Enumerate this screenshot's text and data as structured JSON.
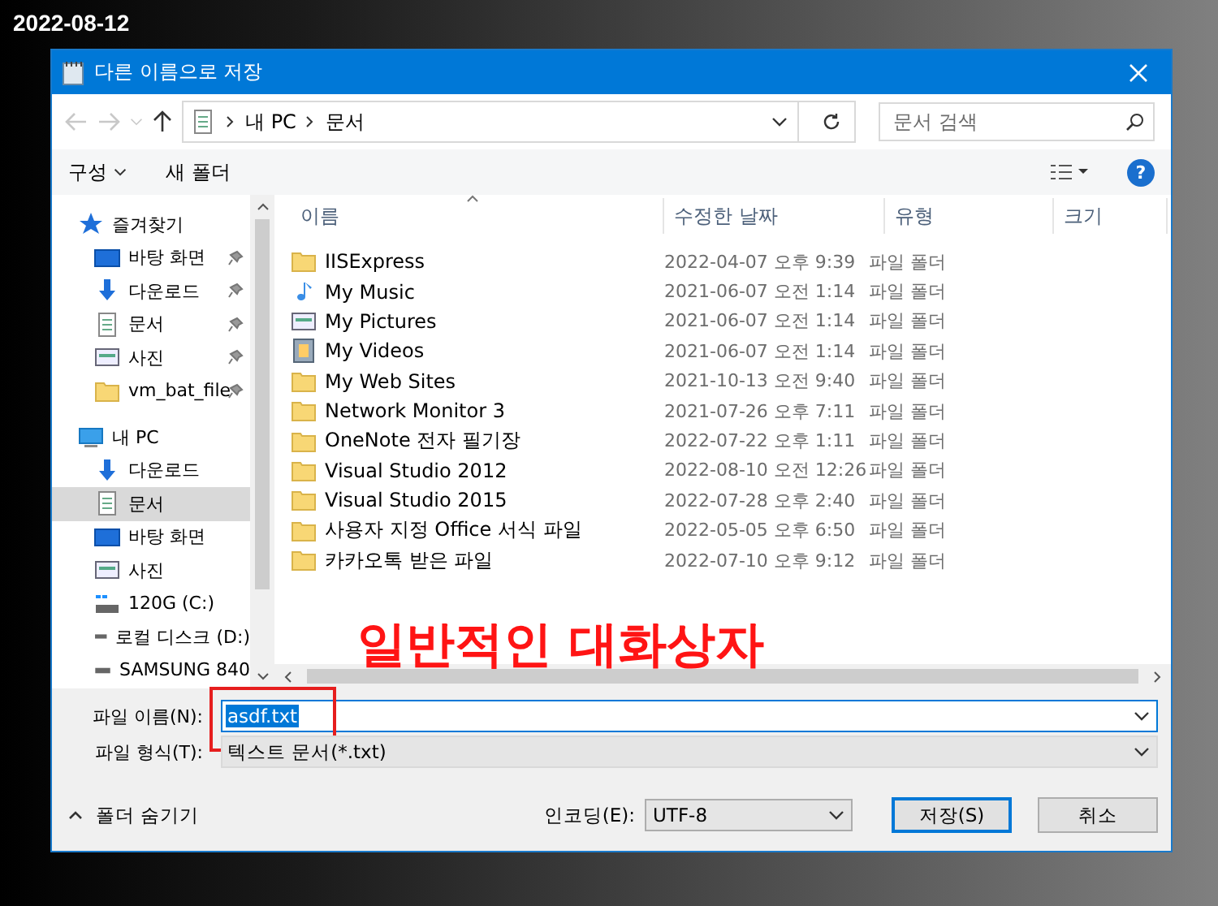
{
  "caption": "2022-08-12",
  "window": {
    "title": "다른 이름으로 저장"
  },
  "address": {
    "path": [
      "내 PC",
      "문서"
    ],
    "search": {
      "placeholder": "문서 검색"
    }
  },
  "toolbar": {
    "organize": "구성",
    "new_folder": "새 폴더",
    "help": "?"
  },
  "sidebar": {
    "groups": [
      {
        "label": "즐겨찾기",
        "kind": "star",
        "children": [
          {
            "label": "바탕 화면",
            "kind": "desktop",
            "pinned": true,
            "selected": false
          },
          {
            "label": "다운로드",
            "kind": "download",
            "pinned": true,
            "selected": false
          },
          {
            "label": "문서",
            "kind": "document",
            "pinned": true,
            "selected": false
          },
          {
            "label": "사진",
            "kind": "picture",
            "pinned": true,
            "selected": false
          },
          {
            "label": "vm_bat_file",
            "kind": "folder",
            "pinned": true,
            "selected": false
          }
        ]
      },
      {
        "label": "내 PC",
        "kind": "pc",
        "children": [
          {
            "label": "다운로드",
            "kind": "download",
            "pinned": false,
            "selected": false
          },
          {
            "label": "문서",
            "kind": "document",
            "pinned": false,
            "selected": true
          },
          {
            "label": "바탕 화면",
            "kind": "desktop",
            "pinned": false,
            "selected": false
          },
          {
            "label": "사진",
            "kind": "picture",
            "pinned": false,
            "selected": false
          },
          {
            "label": "120G (C:)",
            "kind": "system-drive",
            "pinned": false,
            "selected": false
          },
          {
            "label": "로컬 디스크 (D:)",
            "kind": "drive",
            "pinned": false,
            "selected": false
          },
          {
            "label": "SAMSUNG 840",
            "kind": "drive",
            "pinned": false,
            "selected": false
          }
        ]
      }
    ]
  },
  "table": {
    "columns": [
      "이름",
      "수정한 날짜",
      "유형",
      "크기"
    ],
    "rows": [
      {
        "kind": "folder",
        "name": "IISExpress",
        "modified": "2022-04-07 오후 9:39",
        "type": "파일 폴더"
      },
      {
        "kind": "music",
        "name": "My Music",
        "modified": "2021-06-07 오전 1:14",
        "type": "파일 폴더"
      },
      {
        "kind": "picture",
        "name": "My Pictures",
        "modified": "2021-06-07 오전 1:14",
        "type": "파일 폴더"
      },
      {
        "kind": "video",
        "name": "My Videos",
        "modified": "2021-06-07 오전 1:14",
        "type": "파일 폴더"
      },
      {
        "kind": "folder",
        "name": "My Web Sites",
        "modified": "2021-10-13 오전 9:40",
        "type": "파일 폴더"
      },
      {
        "kind": "folder",
        "name": "Network Monitor 3",
        "modified": "2021-07-26 오후 7:11",
        "type": "파일 폴더"
      },
      {
        "kind": "folder",
        "name": "OneNote 전자 필기장",
        "modified": "2022-07-22 오후 1:11",
        "type": "파일 폴더"
      },
      {
        "kind": "folder",
        "name": "Visual Studio 2012",
        "modified": "2022-08-10 오전 12:26",
        "type": "파일 폴더"
      },
      {
        "kind": "folder",
        "name": "Visual Studio 2015",
        "modified": "2022-07-28 오후 2:40",
        "type": "파일 폴더"
      },
      {
        "kind": "folder",
        "name": "사용자 지정 Office 서식 파일",
        "modified": "2022-05-05 오후 6:50",
        "type": "파일 폴더"
      },
      {
        "kind": "folder",
        "name": "카카오톡 받은 파일",
        "modified": "2022-07-10 오후 9:12",
        "type": "파일 폴더"
      }
    ]
  },
  "annotation": {
    "text": "일반적인 대화상자"
  },
  "file_name": {
    "label": "파일 이름(N):",
    "value": "asdf.txt"
  },
  "file_type": {
    "label": "파일 형식(T):",
    "value": "텍스트 문서(*.txt)"
  },
  "hide_folders": "폴더 숨기기",
  "encoding": {
    "label": "인코딩(E):",
    "value": "UTF-8"
  },
  "buttons": [
    {
      "label": "저장(S)",
      "default": true
    },
    {
      "label": "취소",
      "default": false
    }
  ]
}
